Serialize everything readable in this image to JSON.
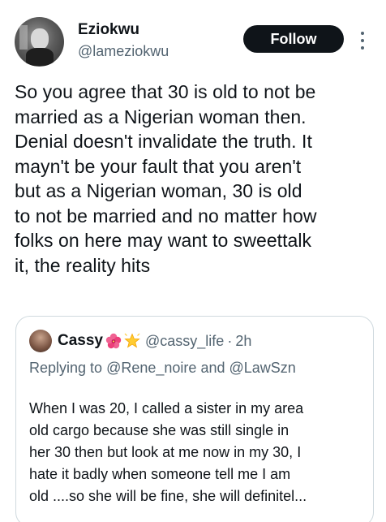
{
  "author": {
    "display_name": "Eziokwu",
    "handle": "@lameziokwu",
    "avatar_icon": "profile-photo"
  },
  "actions": {
    "follow_label": "Follow",
    "more_icon": "more-options-icon"
  },
  "tweet": {
    "lines": [
      "So you agree that 30 is old to not be",
      "married as a Nigerian woman then.",
      "Denial doesn't invalidate the truth. It",
      "mayn't be your fault that you aren't",
      "but as a Nigerian woman, 30 is old",
      "to not be married and no matter how",
      "folks on here may want to sweettalk",
      "it, the reality hits"
    ]
  },
  "quoted": {
    "display_name": "Cassy",
    "emojis": [
      "hibiscus-emoji",
      "glowing-star-emoji"
    ],
    "handle": "@cassy_life",
    "separator": "·",
    "time": "2h",
    "reply_prefix": "Replying to",
    "reply_to_1": "@Rene_noire",
    "reply_and": "and",
    "reply_to_2": "@LawSzn",
    "lines": [
      "When I was 20, I called a sister in my area",
      "old cargo because she was still single in",
      "her 30 then but look at me now in my 30, I",
      "hate it badly when someone tell me I am",
      "old ....so she will be fine, she will definitel..."
    ]
  },
  "colors": {
    "text": "#0f1419",
    "secondary": "#536471",
    "border": "#cfd9de",
    "button": "#0f1419"
  }
}
